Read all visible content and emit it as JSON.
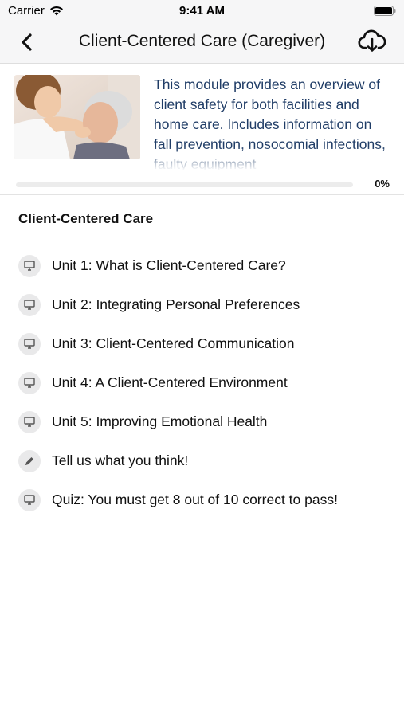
{
  "status_bar": {
    "carrier": "Carrier",
    "time": "9:41 AM"
  },
  "nav": {
    "title": "Client-Centered Care (Caregiver)",
    "back_icon": "chevron-left-icon",
    "download_icon": "cloud-download-icon"
  },
  "module": {
    "description": "This module provides an overview of client safety for both facilities and home care. Includes information on fall prevention, nosocomial infections, faulty equipment",
    "progress": 0,
    "progress_label": "0%"
  },
  "section": {
    "title": "Client-Centered Care"
  },
  "units": [
    {
      "label": "Unit 1: What is Client-Centered Care?",
      "icon": "monitor-icon"
    },
    {
      "label": "Unit 2: Integrating Personal Preferences",
      "icon": "monitor-icon"
    },
    {
      "label": "Unit 3: Client-Centered Communication",
      "icon": "monitor-icon"
    },
    {
      "label": "Unit 4: A Client-Centered Environment",
      "icon": "monitor-icon"
    },
    {
      "label": "Unit 5: Improving Emotional Health",
      "icon": "monitor-icon"
    },
    {
      "label": "Tell us what you think!",
      "icon": "pencil-icon"
    },
    {
      "label": "Quiz: You must get 8 out of 10 correct to pass!",
      "icon": "monitor-icon"
    }
  ],
  "colors": {
    "description_text": "#1f3c66",
    "progress_fill": "#4a90e2",
    "icon_bg": "#e9e9ea"
  }
}
